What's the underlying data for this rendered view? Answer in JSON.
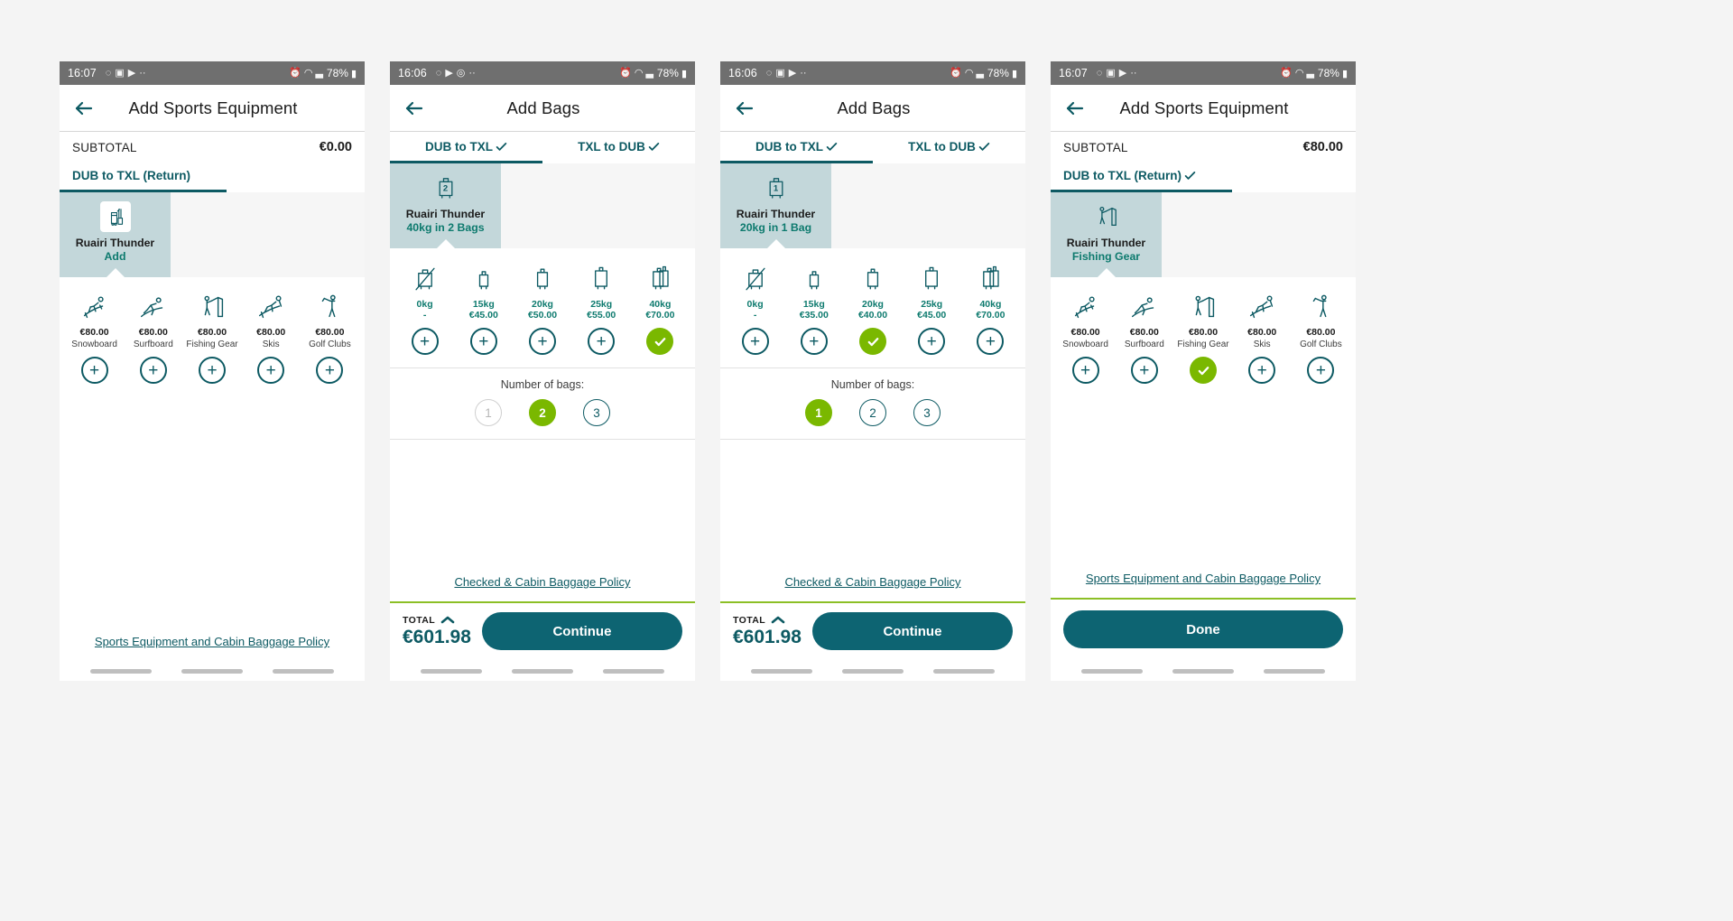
{
  "theme": {
    "teal": "#0d5a63",
    "teal_text": "#0d7a6e",
    "green": "#7ab800",
    "pax_bg": "#c3d7da",
    "cta_bg": "#0d6472",
    "statusbar_bg": "#6f6f6f",
    "page_bg": "#f4f4f4"
  },
  "panels": [
    {
      "id": "panel-sports-empty",
      "statusbar": {
        "time": "16:07",
        "left_icons": [
          "whatsapp-icon",
          "photos-icon",
          "play-icon",
          "more-icon"
        ],
        "right_icons": [
          "alarm-icon",
          "wifi-icon",
          "signal-icon"
        ],
        "battery": "78%"
      },
      "appbar": {
        "back": "back-arrow-icon",
        "title": "Add Sports Equipment"
      },
      "subtotal": {
        "label": "SUBTOTAL",
        "value": "€0.00"
      },
      "tabs": [
        {
          "label": "DUB to TXL (Return)",
          "checked": false,
          "active": true
        }
      ],
      "passenger": {
        "icon": "golf-bag-icon",
        "name": "Ruairi Thunder",
        "sub": "Add",
        "boxed_icon": true
      },
      "options": [
        {
          "icon": "snowboard-icon",
          "price": "€80.00",
          "name": "Snowboard",
          "state": "plus"
        },
        {
          "icon": "surfboard-icon",
          "price": "€80.00",
          "name": "Surfboard",
          "state": "plus"
        },
        {
          "icon": "fishing-gear-icon",
          "price": "€80.00",
          "name": "Fishing Gear",
          "state": "plus"
        },
        {
          "icon": "skis-icon",
          "price": "€80.00",
          "name": "Skis",
          "state": "plus"
        },
        {
          "icon": "golf-clubs-icon",
          "price": "€80.00",
          "name": "Golf Clubs",
          "state": "plus"
        }
      ],
      "number_of_bags": null,
      "policy_link": "Sports Equipment and Cabin Baggage Policy",
      "footer": null,
      "nav_pills": 3
    },
    {
      "id": "panel-bags-2bags",
      "statusbar": {
        "time": "16:06",
        "left_icons": [
          "whatsapp-icon",
          "play-icon",
          "clock-icon",
          "more-icon"
        ],
        "right_icons": [
          "alarm-icon",
          "wifi-icon",
          "signal-icon"
        ],
        "battery": "78%"
      },
      "appbar": {
        "back": "back-arrow-icon",
        "title": "Add Bags"
      },
      "subtotal": null,
      "tabs": [
        {
          "label": "DUB to TXL",
          "checked": true,
          "active": true
        },
        {
          "label": "TXL to DUB",
          "checked": true,
          "active": false
        }
      ],
      "passenger": {
        "icon": "suitcase-badge-icon",
        "badge": "2",
        "name": "Ruairi Thunder",
        "sub": "40kg in 2 Bags",
        "boxed_icon": false
      },
      "options": [
        {
          "icon": "no-bag-icon",
          "kg": "0kg",
          "cost": "-",
          "state": "plus"
        },
        {
          "icon": "bag-small-icon",
          "kg": "15kg",
          "cost": "€45.00",
          "state": "plus"
        },
        {
          "icon": "bag-medium-icon",
          "kg": "20kg",
          "cost": "€50.00",
          "state": "plus"
        },
        {
          "icon": "bag-large-icon",
          "kg": "25kg",
          "cost": "€55.00",
          "state": "plus"
        },
        {
          "icon": "bag-double-icon",
          "kg": "40kg",
          "cost": "€70.00",
          "state": "check"
        }
      ],
      "number_of_bags": {
        "label": "Number of bags:",
        "items": [
          {
            "value": "1",
            "state": "disabled"
          },
          {
            "value": "2",
            "state": "selected"
          },
          {
            "value": "3",
            "state": "available"
          }
        ]
      },
      "policy_link": "Checked & Cabin Baggage Policy",
      "footer": {
        "total_label": "TOTAL",
        "total_value": "€601.98",
        "cta": "Continue",
        "chevron": "chevron-up-icon"
      },
      "nav_pills": 3
    },
    {
      "id": "panel-bags-1bag",
      "statusbar": {
        "time": "16:06",
        "left_icons": [
          "whatsapp-icon",
          "photos-icon",
          "play-icon",
          "more-icon"
        ],
        "right_icons": [
          "alarm-icon",
          "wifi-icon",
          "signal-icon"
        ],
        "battery": "78%"
      },
      "appbar": {
        "back": "back-arrow-icon",
        "title": "Add Bags"
      },
      "subtotal": null,
      "tabs": [
        {
          "label": "DUB to TXL",
          "checked": true,
          "active": true
        },
        {
          "label": "TXL to DUB",
          "checked": true,
          "active": false
        }
      ],
      "passenger": {
        "icon": "suitcase-badge-icon",
        "badge": "1",
        "name": "Ruairi Thunder",
        "sub": "20kg in 1 Bag",
        "boxed_icon": false
      },
      "options": [
        {
          "icon": "no-bag-icon",
          "kg": "0kg",
          "cost": "-",
          "state": "plus"
        },
        {
          "icon": "bag-small-icon",
          "kg": "15kg",
          "cost": "€35.00",
          "state": "plus"
        },
        {
          "icon": "bag-medium-icon",
          "kg": "20kg",
          "cost": "€40.00",
          "state": "check"
        },
        {
          "icon": "bag-large-icon",
          "kg": "25kg",
          "cost": "€45.00",
          "state": "plus"
        },
        {
          "icon": "bag-double-icon",
          "kg": "40kg",
          "cost": "€70.00",
          "state": "plus"
        }
      ],
      "number_of_bags": {
        "label": "Number of bags:",
        "items": [
          {
            "value": "1",
            "state": "selected"
          },
          {
            "value": "2",
            "state": "available"
          },
          {
            "value": "3",
            "state": "available"
          }
        ]
      },
      "policy_link": "Checked & Cabin Baggage Policy",
      "footer": {
        "total_label": "TOTAL",
        "total_value": "€601.98",
        "cta": "Continue",
        "chevron": "chevron-up-icon"
      },
      "nav_pills": 3
    },
    {
      "id": "panel-sports-selected",
      "statusbar": {
        "time": "16:07",
        "left_icons": [
          "whatsapp-icon",
          "photos-icon",
          "play-icon",
          "more-icon"
        ],
        "right_icons": [
          "alarm-icon",
          "wifi-icon",
          "signal-icon"
        ],
        "battery": "78%"
      },
      "appbar": {
        "back": "back-arrow-icon",
        "title": "Add Sports Equipment"
      },
      "subtotal": {
        "label": "SUBTOTAL",
        "value": "€80.00"
      },
      "tabs": [
        {
          "label": "DUB to TXL (Return)",
          "checked": true,
          "active": true
        }
      ],
      "passenger": {
        "icon": "fishing-gear-icon",
        "name": "Ruairi Thunder",
        "sub": "Fishing Gear",
        "boxed_icon": false
      },
      "options": [
        {
          "icon": "snowboard-icon",
          "price": "€80.00",
          "name": "Snowboard",
          "state": "plus"
        },
        {
          "icon": "surfboard-icon",
          "price": "€80.00",
          "name": "Surfboard",
          "state": "plus"
        },
        {
          "icon": "fishing-gear-icon",
          "price": "€80.00",
          "name": "Fishing Gear",
          "state": "check"
        },
        {
          "icon": "skis-icon",
          "price": "€80.00",
          "name": "Skis",
          "state": "plus"
        },
        {
          "icon": "golf-clubs-icon",
          "price": "€80.00",
          "name": "Golf Clubs",
          "state": "plus"
        }
      ],
      "number_of_bags": null,
      "policy_link": "Sports Equipment and Cabin Baggage Policy",
      "footer": {
        "total_label": null,
        "total_value": null,
        "cta": "Done",
        "chevron": null
      },
      "nav_pills": 3
    }
  ]
}
